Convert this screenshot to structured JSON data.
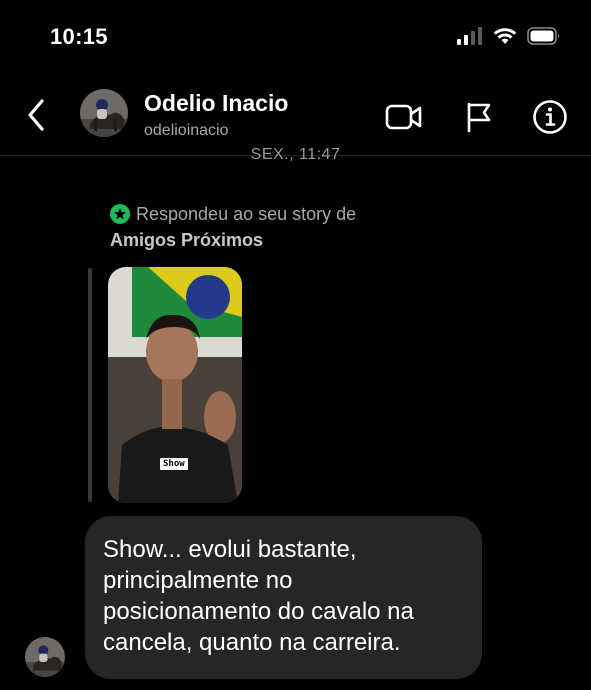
{
  "status_bar": {
    "time": "10:15",
    "icons": [
      "cellular-signal-icon",
      "wifi-icon",
      "battery-icon"
    ]
  },
  "header": {
    "back_icon": "chevron-left-icon",
    "contact_name": "Odelio Inacio",
    "username": "odelioinacio",
    "actions": [
      "video-call-icon",
      "report-flag-icon",
      "info-icon"
    ]
  },
  "chat": {
    "timestamp": "SEX., 11:47",
    "reply_context": {
      "text": "Respondeu ao seu story de",
      "story_name": "Amigos Próximos",
      "accent_color": "#1fb95a"
    },
    "story_sticker": "Show",
    "message": "Show... evolui bastante, principalmente no posicionamento do cavalo na cancela, quanto na carreira."
  },
  "colors": {
    "background": "#000000",
    "bubble": "#262626",
    "secondary_text": "#a8a8a8"
  }
}
